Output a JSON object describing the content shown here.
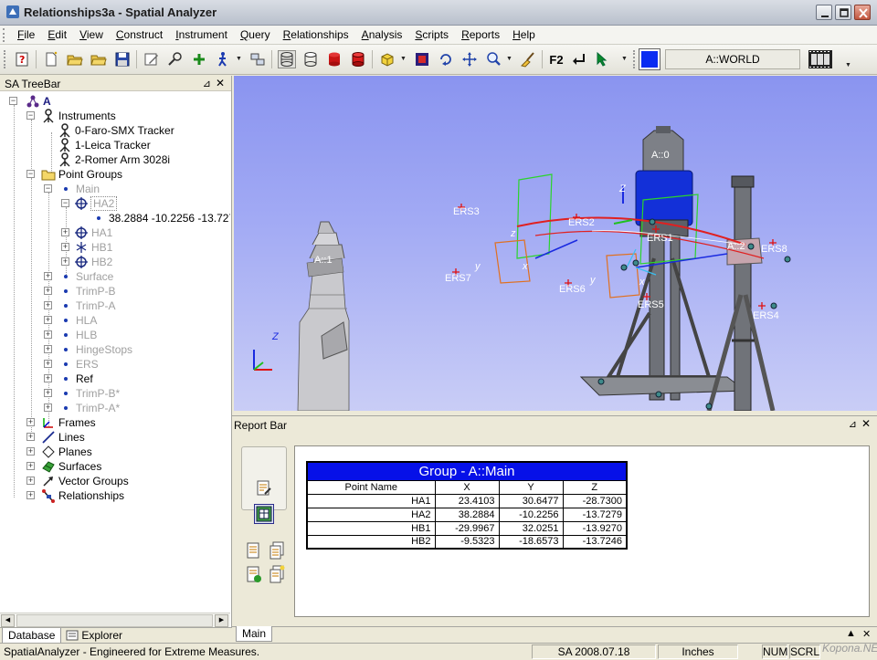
{
  "window": {
    "title": "Relationships3a - Spatial Analyzer"
  },
  "menu": [
    "File",
    "Edit",
    "View",
    "Construct",
    "Instrument",
    "Query",
    "Relationships",
    "Analysis",
    "Scripts",
    "Reports",
    "Help"
  ],
  "toolbar": {
    "f2_label": "F2",
    "world_label": "A::WORLD",
    "world_color": "#0a2cf2"
  },
  "tree_panel": {
    "title": "SA TreeBar",
    "root": "A",
    "instruments_label": "Instruments",
    "instruments": [
      "0-Faro-SMX Tracker",
      "1-Leica Tracker",
      "2-Romer Arm 3028i"
    ],
    "point_groups_label": "Point Groups",
    "main_group": "Main",
    "ha2": "HA2",
    "ha2_point": "38.2884 -10.2256 -13.7279",
    "main_children": [
      "HA1",
      "HB1",
      "HB2"
    ],
    "other_groups": [
      "Surface",
      "TrimP-B",
      "TrimP-A",
      "HLA",
      "HLB",
      "HingeStops",
      "ERS",
      "Ref",
      "TrimP-B*",
      "TrimP-A*"
    ],
    "categories": [
      "Frames",
      "Lines",
      "Planes",
      "Surfaces",
      "Vector Groups",
      "Relationships"
    ]
  },
  "tree_tabs": [
    "Database",
    "Explorer"
  ],
  "viewport": {
    "labels": [
      "ERS3",
      "ERS2",
      "ERS1",
      "ERS7",
      "ERS6",
      "ERS5",
      "ERS8",
      "ERS4",
      "A::0",
      "A::2",
      "A::1"
    ],
    "axes": [
      "z",
      "y",
      "x",
      "Z",
      "y",
      "x",
      "Z"
    ]
  },
  "report_bar": {
    "title": "Report Bar",
    "table_title": "Group - A::Main",
    "columns": [
      "Point Name",
      "X",
      "Y",
      "Z"
    ],
    "rows": [
      [
        "HA1",
        "23.4103",
        "30.6477",
        "-28.7300"
      ],
      [
        "HA2",
        "38.2884",
        "-10.2256",
        "-13.7279"
      ],
      [
        "HB1",
        "-29.9967",
        "32.0251",
        "-13.9270"
      ],
      [
        "HB2",
        "-9.5323",
        "-18.6573",
        "-13.7246"
      ]
    ],
    "tab": "Main"
  },
  "status": {
    "message": "SpatialAnalyzer - Engineered for Extreme Measures.",
    "version": "SA 2008.07.18",
    "units": "Inches",
    "num": "NUM",
    "scrl": "SCRL",
    "watermark": "Kopona.NET"
  }
}
